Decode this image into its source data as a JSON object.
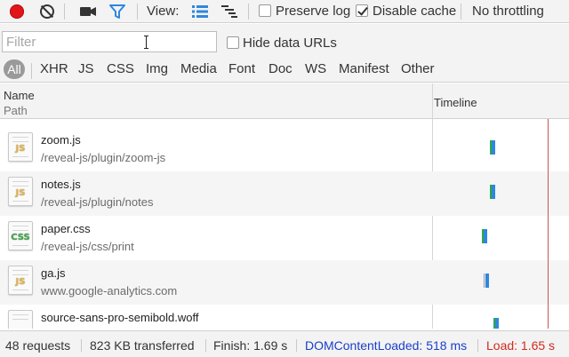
{
  "toolbar": {
    "view_label": "View:",
    "preserve_log": {
      "label": "Preserve log",
      "checked": false
    },
    "disable_cache": {
      "label": "Disable cache",
      "checked": true
    },
    "throttling": "No throttling",
    "icons": {
      "record": "record-icon",
      "clear": "clear-icon",
      "capture": "camera-icon",
      "filter": "filter-icon",
      "view_list": "large-rows-icon",
      "view_waterfall": "waterfall-icon"
    },
    "colors": {
      "record": "#e0161b",
      "active_blue": "#2f86e0"
    }
  },
  "filter": {
    "placeholder": "Filter",
    "value": "",
    "hide_data_urls": {
      "label": "Hide data URLs",
      "checked": false
    }
  },
  "types": [
    "All",
    "XHR",
    "JS",
    "CSS",
    "Img",
    "Media",
    "Font",
    "Doc",
    "WS",
    "Manifest",
    "Other"
  ],
  "columns": {
    "name": "Name",
    "path": "Path",
    "timeline": "Timeline"
  },
  "requests": [
    {
      "name": "zoom.js",
      "path": "/reveal-js/plugin/zoom-js",
      "type": "JS"
    },
    {
      "name": "notes.js",
      "path": "/reveal-js/plugin/notes",
      "type": "JS"
    },
    {
      "name": "paper.css",
      "path": "/reveal-js/css/print",
      "type": "CSS"
    },
    {
      "name": "ga.js",
      "path": "www.google-analytics.com",
      "type": "JS"
    },
    {
      "name": "source-sans-pro-semibold.woff",
      "path": "",
      "type": ""
    }
  ],
  "status": {
    "requests": "48 requests",
    "transferred": "823 KB transferred",
    "finish": "Finish: 1.69 s",
    "dom_content_loaded": "DOMContentLoaded: 518 ms",
    "load": "Load: 1.65 s",
    "colors": {
      "dom_content_loaded": "#1a3fc9",
      "load": "#d12a1f"
    }
  }
}
